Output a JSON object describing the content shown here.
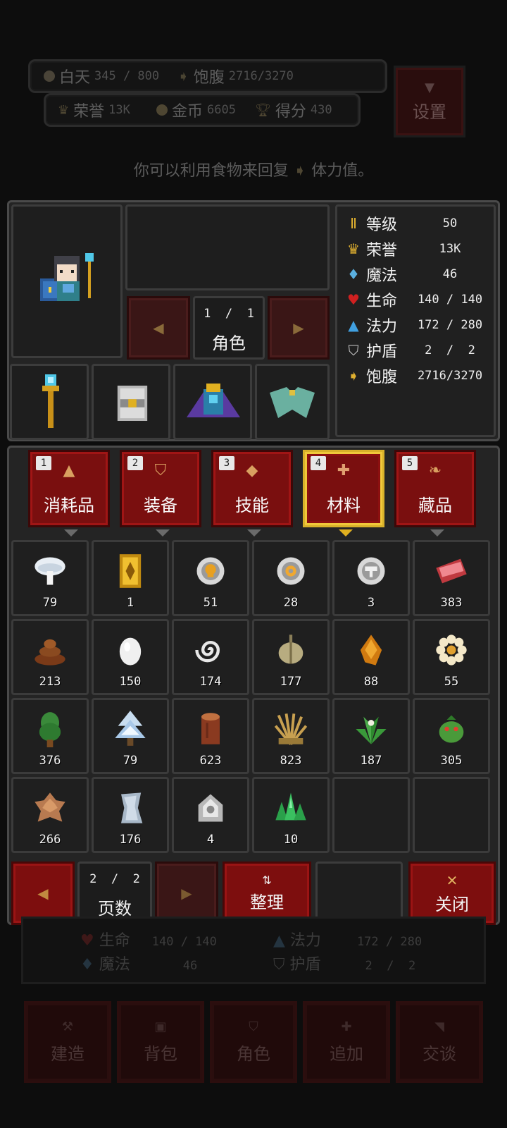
{
  "status": {
    "day_label": "白天",
    "day_value": "345 / 800",
    "satiety_label": "饱腹",
    "satiety_value": "2716/3270",
    "honor_label": "荣誉",
    "honor_value": "13K",
    "gold_label": "金币",
    "gold_value": "6605",
    "score_label": "得分",
    "score_value": "430"
  },
  "settings_label": "设置",
  "hint": {
    "before": "你可以利用食物来回复",
    "after": "体力值。"
  },
  "character": {
    "page": "1  /  1",
    "label": "角色",
    "equipment": [
      "staff-icon",
      "tome-icon",
      "crown-armor-icon",
      "cape-icon"
    ]
  },
  "stats": [
    {
      "icon": "level-icon",
      "label": "等级",
      "value": "50",
      "color": "#e0b030"
    },
    {
      "icon": "crown-icon",
      "label": "荣誉",
      "value": "13K",
      "color": "#e0b030"
    },
    {
      "icon": "magic-icon",
      "label": "魔法",
      "value": "46",
      "color": "#5ab0e0"
    },
    {
      "icon": "heart-icon",
      "label": "生命",
      "value": "140 / 140",
      "color": "#d02020"
    },
    {
      "icon": "potion-icon",
      "label": "法力",
      "value": "172 / 280",
      "color": "#40a0e0"
    },
    {
      "icon": "shield-icon",
      "label": "护盾",
      "value": "2  /  2",
      "color": "#c8c8c8"
    },
    {
      "icon": "satiety-icon",
      "label": "饱腹",
      "value": "2716/3270",
      "color": "#e0b030"
    }
  ],
  "tabs": [
    {
      "num": "1",
      "label": "消耗品",
      "icon": "flask-icon",
      "active": false
    },
    {
      "num": "2",
      "label": "装备",
      "icon": "armor-icon",
      "active": false
    },
    {
      "num": "3",
      "label": "技能",
      "icon": "diamond-icon",
      "active": false
    },
    {
      "num": "4",
      "label": "材料",
      "icon": "plus-icon",
      "active": true
    },
    {
      "num": "5",
      "label": "藏品",
      "icon": "leaf-icon",
      "active": false
    }
  ],
  "items": [
    {
      "icon": "mushroom-icon",
      "count": "79"
    },
    {
      "icon": "gold-card-icon",
      "count": "1"
    },
    {
      "icon": "skull-coin-icon",
      "count": "51"
    },
    {
      "icon": "silver-coin-icon",
      "count": "28"
    },
    {
      "icon": "hammer-coin-icon",
      "count": "3"
    },
    {
      "icon": "meat-icon",
      "count": "383"
    },
    {
      "icon": "dung-icon",
      "count": "213"
    },
    {
      "icon": "egg-icon",
      "count": "150"
    },
    {
      "icon": "spiral-icon",
      "count": "174"
    },
    {
      "icon": "garlic-icon",
      "count": "177"
    },
    {
      "icon": "amber-icon",
      "count": "88"
    },
    {
      "icon": "flower-icon",
      "count": "55"
    },
    {
      "icon": "tree-icon",
      "count": "376"
    },
    {
      "icon": "snow-tree-icon",
      "count": "79"
    },
    {
      "icon": "log-icon",
      "count": "623"
    },
    {
      "icon": "wheat-icon",
      "count": "823"
    },
    {
      "icon": "herb-icon",
      "count": "187"
    },
    {
      "icon": "cactus-icon",
      "count": "305"
    },
    {
      "icon": "hide-icon",
      "count": "266"
    },
    {
      "icon": "cloth-icon",
      "count": "176"
    },
    {
      "icon": "ore-icon",
      "count": "4"
    },
    {
      "icon": "emerald-icon",
      "count": "10"
    },
    {
      "icon": "",
      "count": ""
    },
    {
      "icon": "",
      "count": ""
    }
  ],
  "footer": {
    "page": "2  /  2",
    "page_label": "页数",
    "sort_label": "整理",
    "close_label": "关闭"
  },
  "background": {
    "hp_label": "生命",
    "hp_value": "140 / 140",
    "mp_label": "法力",
    "mp_value": "172 / 280",
    "magic_label": "魔法",
    "magic_value": "46",
    "shield_label": "护盾",
    "shield_value": "2  /  2",
    "nav": [
      "建造",
      "背包",
      "角色",
      "追加",
      "交谈"
    ]
  }
}
